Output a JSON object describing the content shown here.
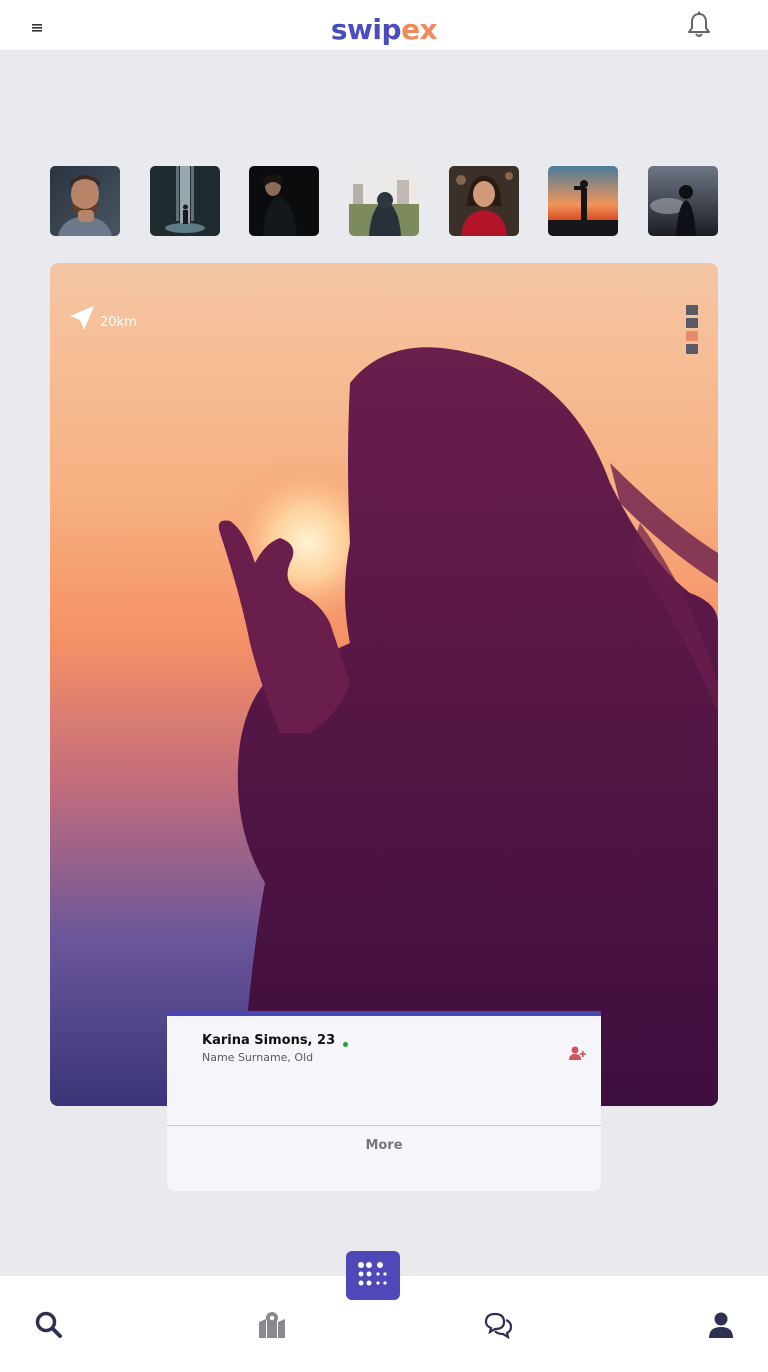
{
  "header": {
    "brand_part1": "swip",
    "brand_part2": "ex",
    "menu_icon": "hamburger-menu-icon",
    "notification_icon": "bell-icon"
  },
  "stories": [
    {
      "icon": "story-man-portrait"
    },
    {
      "icon": "story-waterfall-walker"
    },
    {
      "icon": "story-dark-portrait"
    },
    {
      "icon": "story-city-hoodie"
    },
    {
      "icon": "story-woman-red-sweater"
    },
    {
      "icon": "story-sunset-photographer"
    },
    {
      "icon": "story-cloud-silhouette"
    }
  ],
  "card": {
    "distance": "20km",
    "distance_icon": "location-arrow-icon",
    "pager_count": 4,
    "pager_active_index": 2
  },
  "profile": {
    "name": "Karina Simons, 23",
    "subtitle": "Name Surname, Old",
    "online": true,
    "add_friend_icon": "user-plus-icon",
    "more_label": "More"
  },
  "bottom_nav": {
    "items": [
      "search-icon",
      "map-icon",
      "chat-icon",
      "profile-icon"
    ],
    "center_icon": "grid-dots-icon"
  },
  "colors": {
    "accent": "#4b4cc0",
    "brand_orange": "#ef8a5b",
    "nav_icon": "#2e3152",
    "online": "#1e9e3c",
    "add_friend": "#d0545b"
  }
}
